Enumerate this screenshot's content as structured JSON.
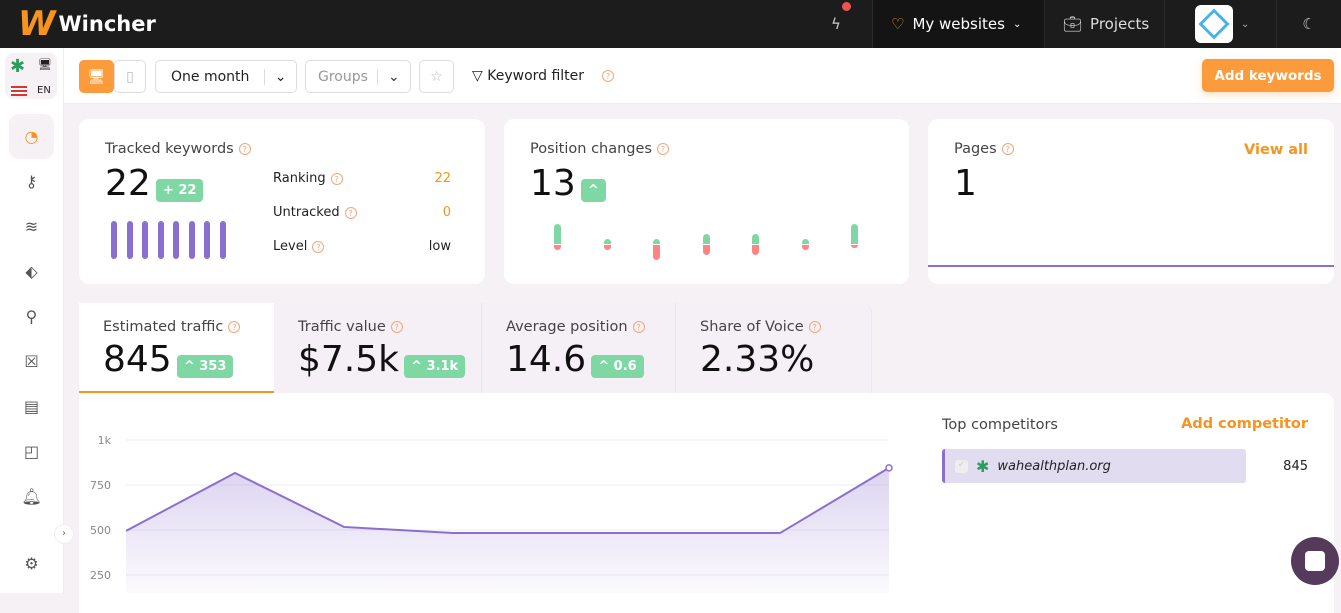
{
  "header": {
    "brand": "Wincher",
    "my_websites": "My websites",
    "projects": "Projects"
  },
  "toolbar": {
    "period": "One month",
    "groups": "Groups",
    "keyword_filter": "Keyword filter",
    "add_keywords": "Add keywords",
    "lang": "EN"
  },
  "tracked": {
    "title": "Tracked keywords",
    "value": "22",
    "badge": "+ 22",
    "rows": [
      {
        "label": "Ranking",
        "value": "22"
      },
      {
        "label": "Untracked",
        "value": "0"
      },
      {
        "label": "Level",
        "value": "low"
      }
    ]
  },
  "position_changes": {
    "title": "Position changes",
    "value": "13",
    "bars": [
      {
        "up": 4,
        "down": 1
      },
      {
        "up": 1,
        "down": 1
      },
      {
        "up": 1,
        "down": 3
      },
      {
        "up": 2,
        "down": 2
      },
      {
        "up": 2,
        "down": 2
      },
      {
        "up": 1,
        "down": 1
      },
      {
        "up": 4,
        "down": 0.5
      }
    ]
  },
  "pages": {
    "title": "Pages",
    "value": "1",
    "view_all": "View all"
  },
  "metrics": [
    {
      "label": "Estimated traffic",
      "value": "845",
      "badge": "353"
    },
    {
      "label": "Traffic value",
      "value": "$7.5k",
      "badge": "3.1k"
    },
    {
      "label": "Average position",
      "value": "14.6",
      "badge": "0.6"
    },
    {
      "label": "Share of Voice",
      "value": "2.33%"
    }
  ],
  "chart_data": {
    "type": "area",
    "y_ticks": [
      "1k",
      "750",
      "500",
      "250"
    ],
    "ylim": [
      0,
      1000
    ],
    "values": [
      495,
      817,
      517,
      483,
      483,
      483,
      483,
      845
    ],
    "color": "#8a6fd0"
  },
  "competitors": {
    "title": "Top competitors",
    "add": "Add competitor",
    "items": [
      {
        "domain": "wahealthplan.org",
        "value": "845"
      }
    ]
  }
}
